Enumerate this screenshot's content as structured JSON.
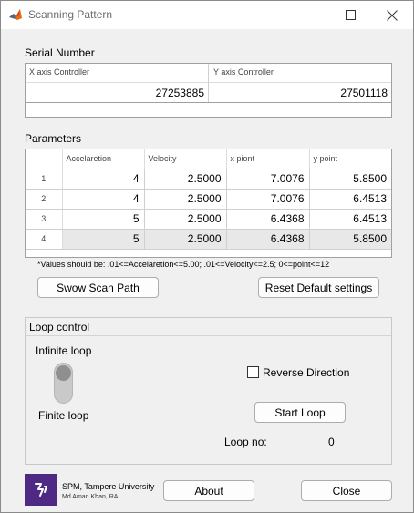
{
  "window": {
    "title": "Scanning Pattern",
    "icon": "matlab-icon"
  },
  "serial": {
    "heading": "Serial Number",
    "columns": [
      "X axis Controller",
      "Y axis Controller"
    ],
    "values": [
      "27253885",
      "27501118"
    ]
  },
  "parameters": {
    "heading": "Parameters",
    "columns": [
      "Accelaretion",
      "Velocity",
      "x piont",
      "y point"
    ],
    "rows": [
      {
        "index": "1",
        "cells": [
          "4",
          "2.5000",
          "7.0076",
          "5.8500"
        ]
      },
      {
        "index": "2",
        "cells": [
          "4",
          "2.5000",
          "7.0076",
          "6.4513"
        ]
      },
      {
        "index": "3",
        "cells": [
          "5",
          "2.5000",
          "6.4368",
          "6.4513"
        ]
      },
      {
        "index": "4",
        "cells": [
          "5",
          "2.5000",
          "6.4368",
          "5.8500"
        ]
      }
    ],
    "note": "*Values should be: .01<=Accelaretion<=5.00; .01<=Velocity<=2.5; 0<=point<=12"
  },
  "buttons": {
    "show_scan_path": "Swow Scan Path",
    "reset_default": "Reset Default settings",
    "start_loop": "Start Loop",
    "about": "About",
    "close": "Close"
  },
  "loop_control": {
    "title": "Loop control",
    "switch_on_label": "Infinite loop",
    "switch_off_label": "Finite loop",
    "reverse_label": "Reverse Direction",
    "reverse_checked": false,
    "loop_no_label": "Loop no:",
    "loop_no_value": "0"
  },
  "footer": {
    "org": "SPM, Tampere University",
    "author": "Md Aman Khan, RA"
  },
  "colors": {
    "window_bg": "#f0f0f0",
    "logo_bg": "#4e2a84",
    "switch_thumb": "#8f8f8f"
  }
}
